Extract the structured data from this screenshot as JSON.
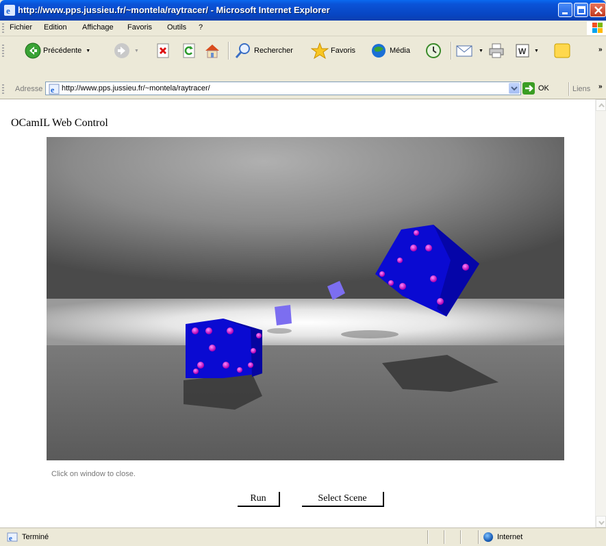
{
  "window": {
    "title": "http://www.pps.jussieu.fr/~montela/raytracer/ - Microsoft Internet Explorer"
  },
  "menu": {
    "items": [
      "Fichier",
      "Edition",
      "Affichage",
      "Favoris",
      "Outils",
      "?"
    ]
  },
  "toolbar": {
    "back_label": "Précédente",
    "search_label": "Rechercher",
    "favorites_label": "Favoris",
    "media_label": "Média"
  },
  "address": {
    "label": "Adresse",
    "url": "http://www.pps.jussieu.fr/~montela/raytracer/",
    "go_label": "OK",
    "links_label": "Liens"
  },
  "page": {
    "title": "OCamIL Web Control",
    "hint": "Click on window to close.",
    "run_label": "Run",
    "select_scene_label": "Select Scene"
  },
  "status": {
    "text": "Terminé",
    "zone": "Internet"
  },
  "icons": {
    "ie": "ie-icon",
    "back": "back-arrow-icon",
    "forward": "forward-arrow-icon",
    "stop": "stop-icon",
    "refresh": "refresh-icon",
    "home": "home-icon",
    "search": "search-icon",
    "favorites": "star-icon",
    "media": "media-icon",
    "history": "history-icon",
    "mail": "mail-icon",
    "print": "print-icon",
    "word": "word-icon",
    "messenger": "messenger-icon"
  },
  "colors": {
    "titlebar": "#0a53d8",
    "dice_blue": "#0a0ad2",
    "dice_pips": "#e020e0"
  }
}
